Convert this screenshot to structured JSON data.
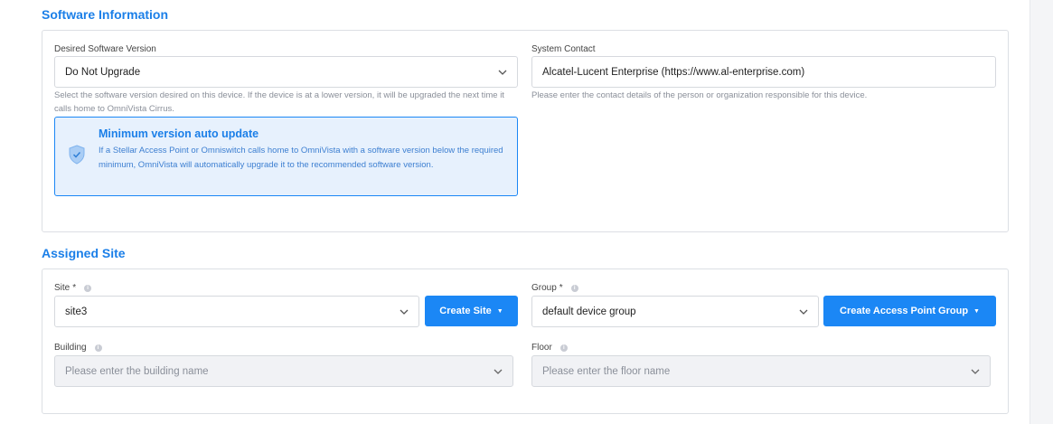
{
  "software": {
    "section_title": "Software Information",
    "desired_version": {
      "label": "Desired Software Version",
      "value": "Do Not Upgrade",
      "help": "Select the software version desired on this device. If the device is at a lower version, it will be upgraded the next time it calls home to OmniVista Cirrus."
    },
    "system_contact": {
      "label": "System Contact",
      "value": "Alcatel-Lucent Enterprise (https://www.al-enterprise.com)",
      "help": "Please enter the contact details of the person or organization responsible for this device."
    },
    "callout": {
      "title": "Minimum version auto update",
      "text": "If a Stellar Access Point or Omniswitch calls home to OmniVista with a software version below the required minimum, OmniVista will automatically upgrade it to the recommended software version."
    }
  },
  "assigned_site": {
    "section_title": "Assigned Site",
    "site": {
      "label": "Site",
      "required": "*",
      "value": "site3",
      "button": "Create Site"
    },
    "group": {
      "label": "Group",
      "required": "*",
      "value": "default device group",
      "button": "Create Access Point Group"
    },
    "building": {
      "label": "Building",
      "placeholder": "Please enter the building name"
    },
    "floor": {
      "label": "Floor",
      "placeholder": "Please enter the floor name"
    }
  },
  "icons": {
    "chevron": "chevron-down-icon",
    "info": "info-icon",
    "shield": "shield-check-icon",
    "caret": "caret-down-icon"
  },
  "colors": {
    "accent": "#1b87f5",
    "section_title": "#1b7fe8",
    "callout_bg": "#e7f1fd"
  }
}
